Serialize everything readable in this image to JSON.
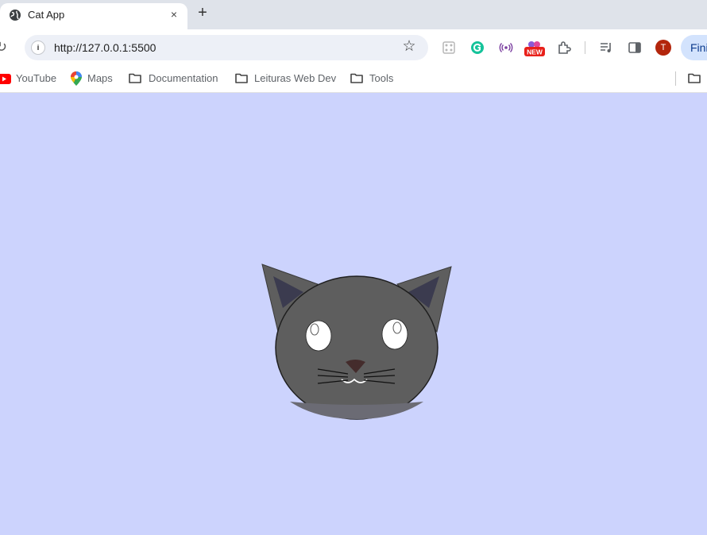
{
  "browser": {
    "tab": {
      "title": "Cat App",
      "close_glyph": "×"
    },
    "newtab_glyph": "+",
    "omnibox": {
      "url": "http://127.0.0.1:5500"
    },
    "ext_badge": "NEW",
    "profile_initial": "T",
    "right_button": "Fini"
  },
  "bookmarks": [
    {
      "label": "YouTube",
      "icon": "youtube-icon"
    },
    {
      "label": "Maps",
      "icon": "maps-pin-icon"
    },
    {
      "label": "Documentation",
      "icon": "folder-icon"
    },
    {
      "label": "Leituras Web Dev",
      "icon": "folder-icon"
    },
    {
      "label": "Tools",
      "icon": "folder-icon"
    }
  ],
  "colors": {
    "page_background": "#ccd3fd",
    "cat_face": "#5e5e5e",
    "cat_ear_inner": "#3b3b4f",
    "cat_nose": "#442c2c"
  }
}
